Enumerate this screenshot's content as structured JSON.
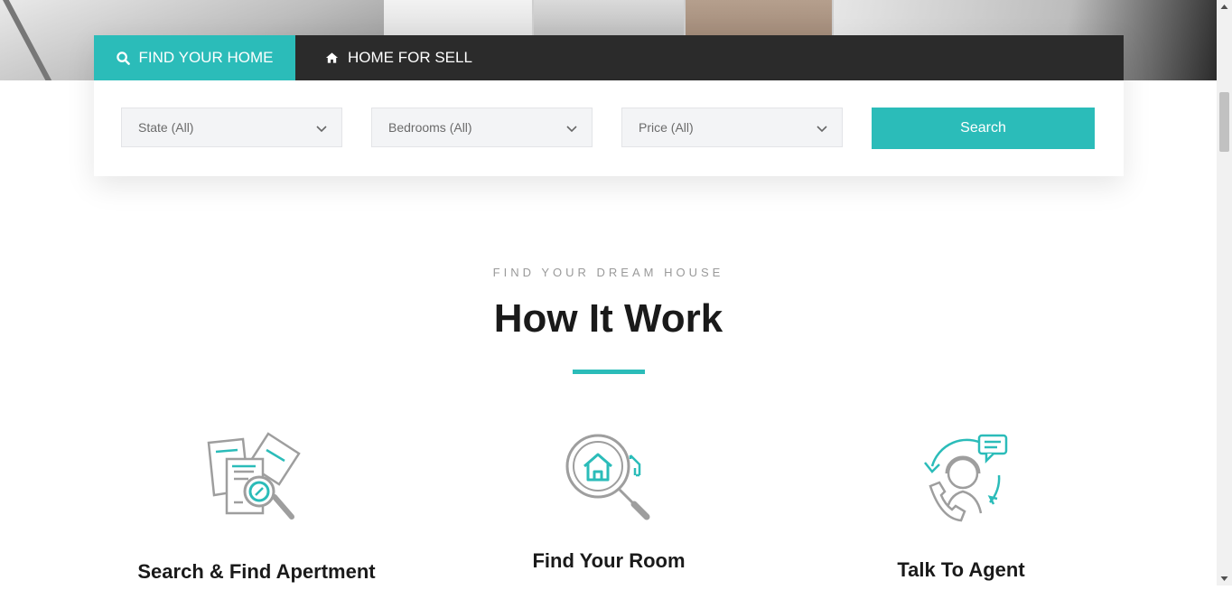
{
  "tabs": {
    "find_label": "FIND YOUR HOME",
    "sell_label": "HOME FOR SELL"
  },
  "search": {
    "state": "State (All)",
    "bedrooms": "Bedrooms (All)",
    "price": "Price (All)",
    "button_label": "Search"
  },
  "section": {
    "eyebrow": "FIND YOUR DREAM HOUSE",
    "title": "How It Work"
  },
  "features": [
    {
      "label": "Search & Find Apertment",
      "icon": "document-search-icon"
    },
    {
      "label": "Find Your Room",
      "icon": "house-magnifier-icon"
    },
    {
      "label": "Talk To Agent",
      "icon": "agent-support-icon"
    }
  ],
  "colors": {
    "accent": "#2bbcb9",
    "tabbar": "#2b2b2b",
    "title": "#1a1a1a"
  }
}
